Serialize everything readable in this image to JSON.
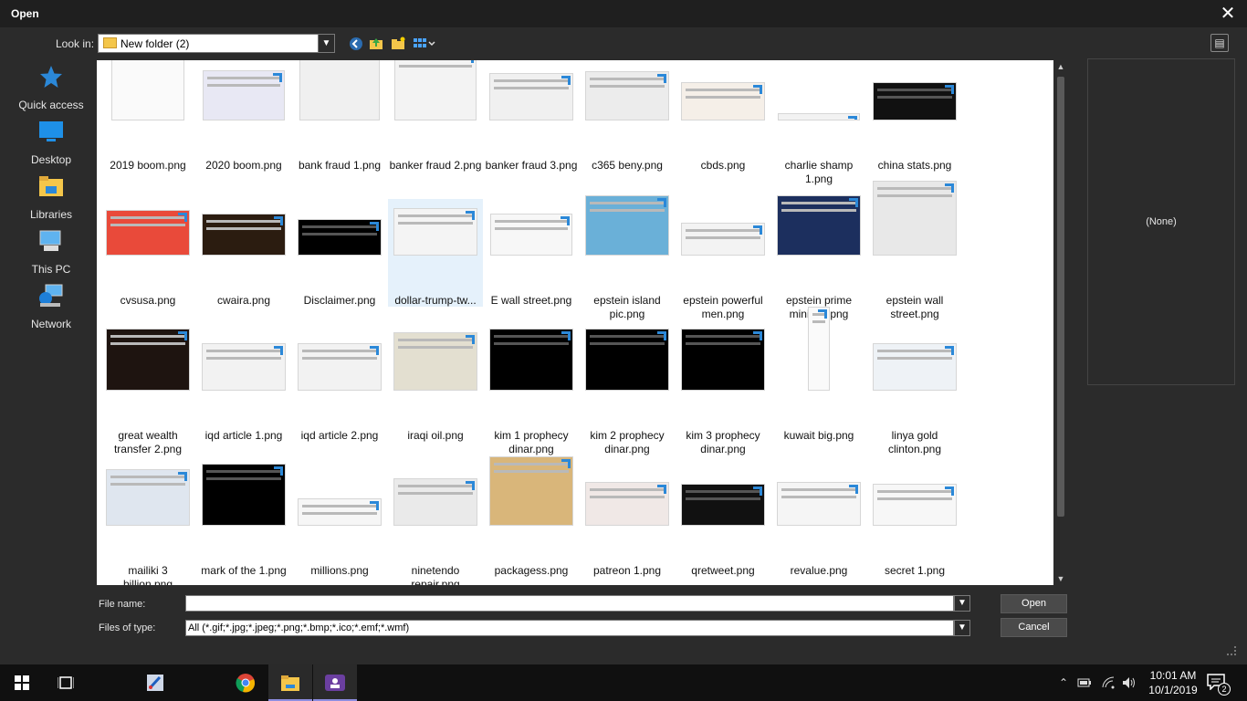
{
  "window": {
    "title": "Open",
    "close_glyph": "✕"
  },
  "toolbar": {
    "look_in_label": "Look in:",
    "look_in_value": "New folder (2)",
    "icons": [
      "back-icon",
      "up-folder-icon",
      "new-folder-icon",
      "view-menu-icon",
      "preview-pane-icon"
    ]
  },
  "places": [
    {
      "label": "Quick access",
      "icon": "star-icon"
    },
    {
      "label": "Desktop",
      "icon": "desktop-icon"
    },
    {
      "label": "Libraries",
      "icon": "libraries-icon"
    },
    {
      "label": "This PC",
      "icon": "computer-icon"
    },
    {
      "label": "Network",
      "icon": "network-icon"
    }
  ],
  "files": [
    {
      "name": "2019 boom.png",
      "line2": ""
    },
    {
      "name": "2020 boom.png",
      "line2": ""
    },
    {
      "name": "bank fraud 1.png",
      "line2": ""
    },
    {
      "name": "banker fraud 2.png",
      "line2": ""
    },
    {
      "name": "banker fraud 3.png",
      "line2": ""
    },
    {
      "name": "c365 beny.png",
      "line2": ""
    },
    {
      "name": "cbds.png",
      "line2": ""
    },
    {
      "name": "charlie shamp",
      "line2": "1.png"
    },
    {
      "name": "china stats.png",
      "line2": ""
    },
    {
      "name": "cvsusa.png",
      "line2": ""
    },
    {
      "name": "cwaira.png",
      "line2": ""
    },
    {
      "name": "Disclaimer.png",
      "line2": ""
    },
    {
      "name": "dollar-trump-tw...",
      "line2": ""
    },
    {
      "name": "E wall street.png",
      "line2": ""
    },
    {
      "name": "epstein island",
      "line2": "pic.png"
    },
    {
      "name": "epstein powerful",
      "line2": "men.png"
    },
    {
      "name": "epstein prime",
      "line2": "minister.png"
    },
    {
      "name": "epstein wall",
      "line2": "street.png"
    },
    {
      "name": "great wealth",
      "line2": "transfer 2.png"
    },
    {
      "name": "iqd article 1.png",
      "line2": ""
    },
    {
      "name": "iqd article 2.png",
      "line2": ""
    },
    {
      "name": "iraqi oil.png",
      "line2": ""
    },
    {
      "name": "kim 1 prophecy",
      "line2": "dinar.png"
    },
    {
      "name": "kim 2 prophecy",
      "line2": "dinar.png"
    },
    {
      "name": "kim 3 prophecy",
      "line2": "dinar.png"
    },
    {
      "name": "kuwait big.png",
      "line2": ""
    },
    {
      "name": "linya gold",
      "line2": "clinton.png"
    },
    {
      "name": "mailiki 3",
      "line2": "billion.png"
    },
    {
      "name": "mark of the 1.png",
      "line2": ""
    },
    {
      "name": "millions.png",
      "line2": ""
    },
    {
      "name": "ninetendo",
      "line2": "repair.png"
    },
    {
      "name": "packagess.png",
      "line2": ""
    },
    {
      "name": "patreon 1.png",
      "line2": ""
    },
    {
      "name": "qretweet.png",
      "line2": ""
    },
    {
      "name": "revalue.png",
      "line2": ""
    },
    {
      "name": "secret 1.png",
      "line2": ""
    }
  ],
  "selected_file": "dollar-trump-tw...",
  "preview": {
    "text": "(None)"
  },
  "fields": {
    "file_name_label": "File name:",
    "file_name_value": "",
    "file_type_label": "Files of type:",
    "file_type_value": "All (*.gif;*.jpg;*.jpeg;*.png;*.bmp;*.ico;*.emf;*.wmf)"
  },
  "buttons": {
    "open": "Open",
    "cancel": "Cancel"
  },
  "taskbar": {
    "time": "10:01 AM",
    "date": "10/1/2019",
    "notification_count": "2",
    "apps": [
      "windows-start-icon",
      "task-view-icon",
      "paint-app-icon",
      "chrome-icon",
      "file-explorer-icon",
      "teams-app-icon"
    ]
  },
  "colors": {
    "accent": "#2b88d8",
    "selection": "#e5f1fb",
    "dialog_bg": "#2b2b2b",
    "taskbar_bg": "#101010"
  }
}
